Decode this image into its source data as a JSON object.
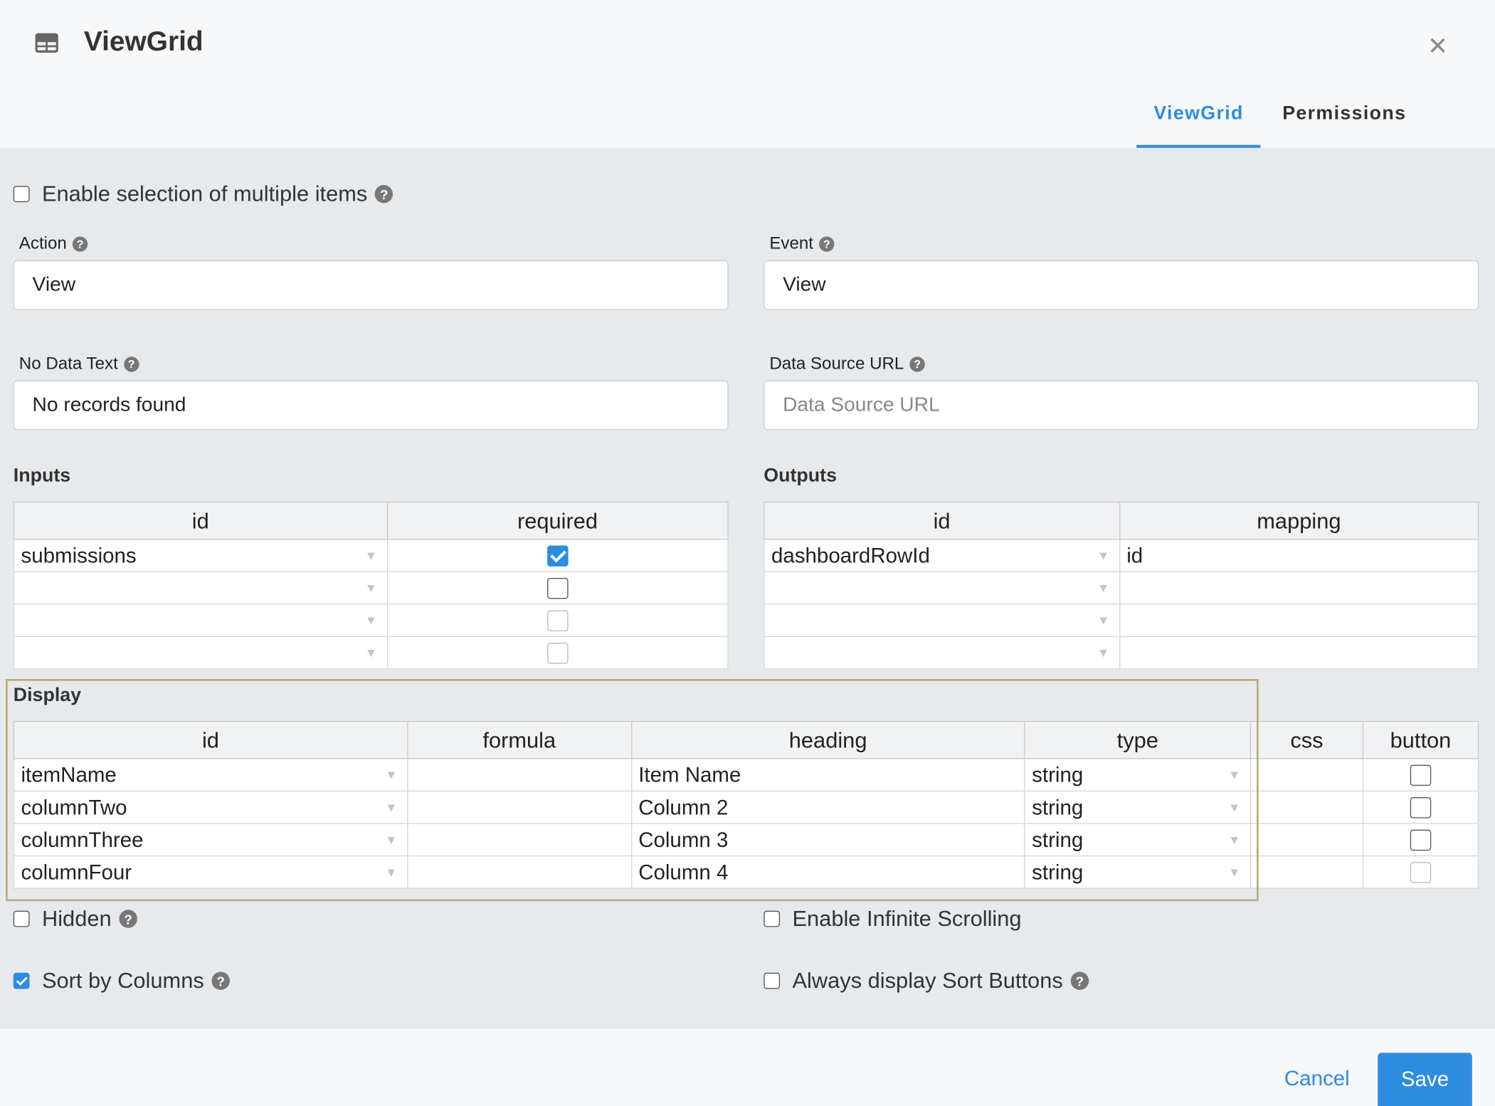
{
  "dialog": {
    "title": "ViewGrid",
    "tabs": [
      {
        "label": "ViewGrid",
        "active": true
      },
      {
        "label": "Permissions",
        "active": false
      }
    ],
    "accent_color": "#2d8ce0"
  },
  "settings": {
    "multi_select_label": "Enable selection of multiple items",
    "multi_select_checked": false,
    "help_glyph": "?",
    "action": {
      "label": "Action",
      "value": "View"
    },
    "event": {
      "label": "Event",
      "value": "View"
    },
    "no_data_text": {
      "label": "No Data Text",
      "value": "No records found"
    },
    "data_source_url": {
      "label": "Data Source URL",
      "placeholder": "Data Source URL",
      "value": ""
    }
  },
  "inputs": {
    "label": "Inputs",
    "headers": [
      "id",
      "required"
    ],
    "rows": [
      {
        "id": "submissions",
        "required": true
      },
      {
        "id": "",
        "required": false
      },
      {
        "id": "",
        "required": false
      },
      {
        "id": "",
        "required": false
      }
    ]
  },
  "outputs": {
    "label": "Outputs",
    "headers": [
      "id",
      "mapping"
    ],
    "rows": [
      {
        "id": "dashboardRowId",
        "mapping": "id"
      },
      {
        "id": "",
        "mapping": ""
      },
      {
        "id": "",
        "mapping": ""
      },
      {
        "id": "",
        "mapping": ""
      }
    ]
  },
  "display": {
    "label": "Display",
    "headers": [
      "id",
      "formula",
      "heading",
      "type",
      "css",
      "button"
    ],
    "rows": [
      {
        "id": "itemName",
        "formula": "",
        "heading": "Item Name",
        "type": "string",
        "css": "",
        "button": false
      },
      {
        "id": "columnTwo",
        "formula": "",
        "heading": "Column 2",
        "type": "string",
        "css": "",
        "button": false
      },
      {
        "id": "columnThree",
        "formula": "",
        "heading": "Column 3",
        "type": "string",
        "css": "",
        "button": false
      },
      {
        "id": "columnFour",
        "formula": "",
        "heading": "Column 4",
        "type": "string",
        "css": "",
        "button": false
      }
    ]
  },
  "options": {
    "hidden": {
      "label": "Hidden",
      "checked": false
    },
    "infinite_scrolling": {
      "label": "Enable Infinite Scrolling",
      "checked": false
    },
    "sort_by_columns": {
      "label": "Sort by Columns",
      "checked": true
    },
    "always_sort_buttons": {
      "label": "Always display Sort Buttons",
      "checked": false
    }
  },
  "footer": {
    "cancel_label": "Cancel",
    "save_label": "Save"
  }
}
